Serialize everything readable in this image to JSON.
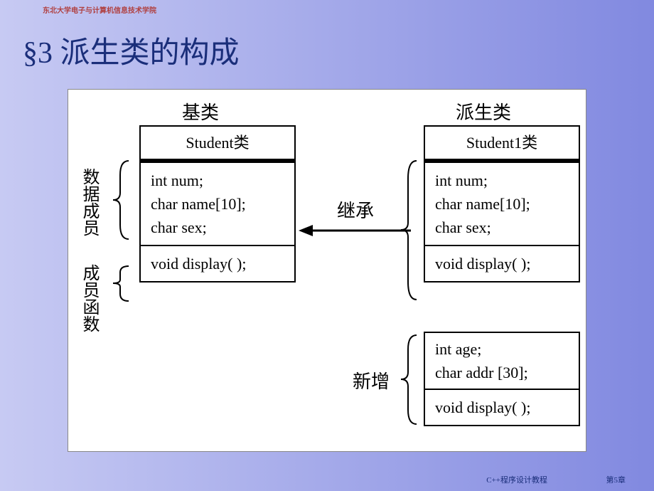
{
  "header": "东北大学电子与计算机信息技术学院",
  "title": "§3 派生类的构成",
  "labels": {
    "base_class": "基类",
    "derived_class": "派生类",
    "data_members": "数据成员",
    "member_functions": "成员函数",
    "inherit": "继承",
    "new": "新增"
  },
  "base": {
    "class_name": "Student类",
    "data_members": "int num;\nchar name[10];\nchar sex;",
    "methods": "void display( );"
  },
  "derived": {
    "class_name": "Student1类",
    "inherited_data": "int num;\nchar name[10];\nchar sex;",
    "inherited_methods": "void display( );",
    "new_data": "int age;\nchar addr [30];",
    "new_methods": "void display( );"
  },
  "footer": {
    "course": "C++程序设计教程",
    "chapter": "第5章"
  }
}
